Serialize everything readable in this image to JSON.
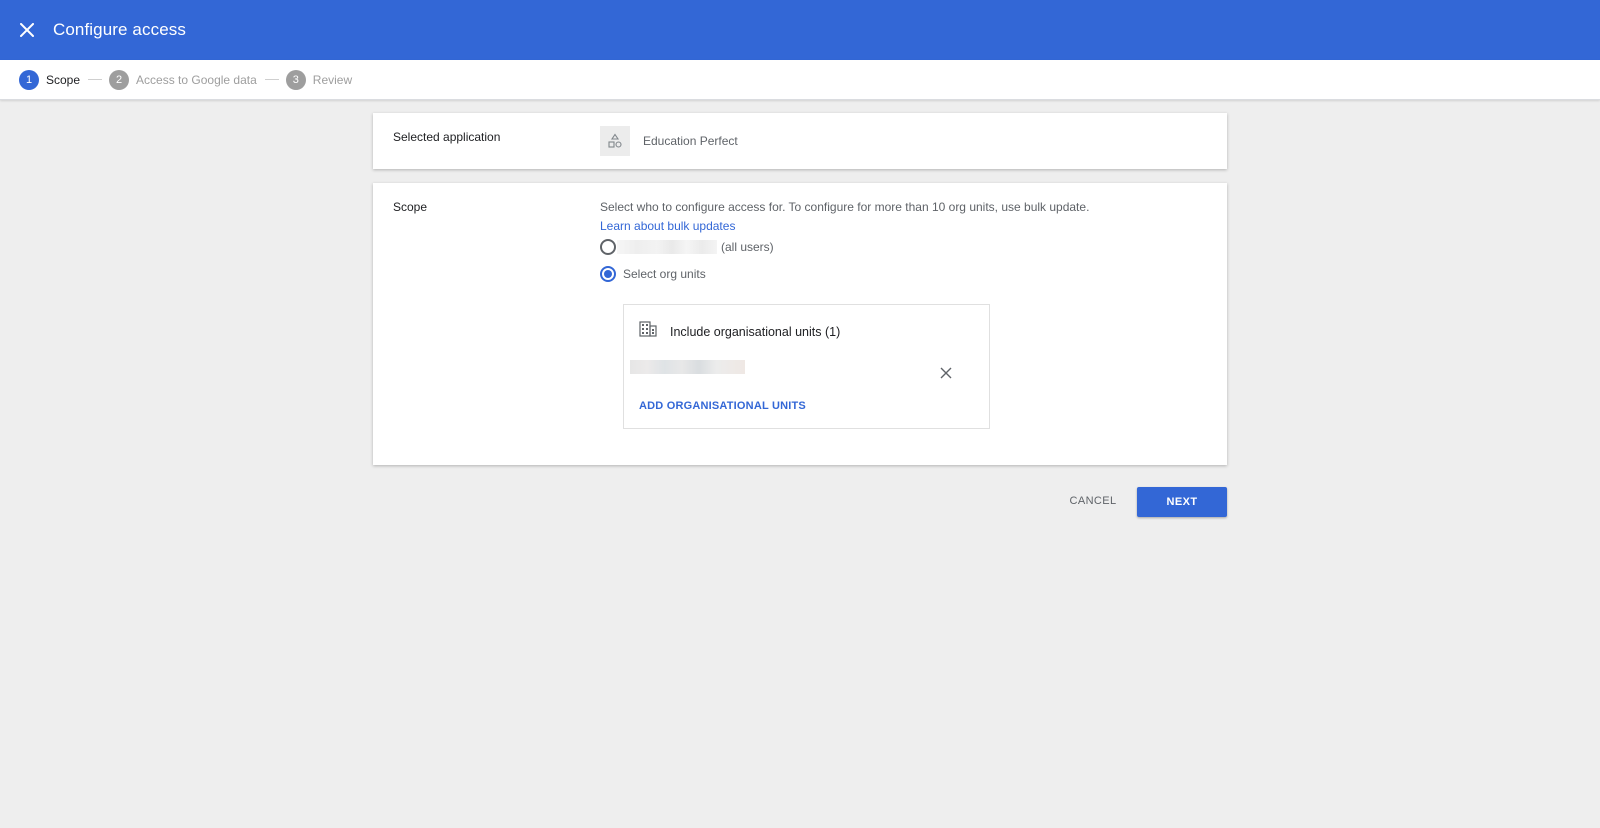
{
  "header": {
    "title": "Configure access",
    "close_icon": "close-icon",
    "color": "#3367d6"
  },
  "stepper": {
    "steps": [
      {
        "number": "1",
        "label": "Scope",
        "active": true
      },
      {
        "number": "2",
        "label": "Access to Google data",
        "active": false
      },
      {
        "number": "3",
        "label": "Review",
        "active": false
      }
    ]
  },
  "app_card": {
    "label": "Selected application",
    "app_name": "Education Perfect",
    "app_icon": "shapes-icon"
  },
  "scope_card": {
    "label": "Scope",
    "description": "Select who to configure access for. To configure for more than 10 org units, use bulk update.",
    "link": "Learn about bulk updates",
    "options": [
      {
        "label": "(all users)",
        "selected": false
      },
      {
        "label": "Select org units",
        "selected": true
      }
    ],
    "org_units": {
      "title": "Include organisational units (1)",
      "icon": "building-icon",
      "add_label": "ADD ORGANISATIONAL UNITS"
    }
  },
  "actions": {
    "cancel": "CANCEL",
    "next": "NEXT"
  }
}
